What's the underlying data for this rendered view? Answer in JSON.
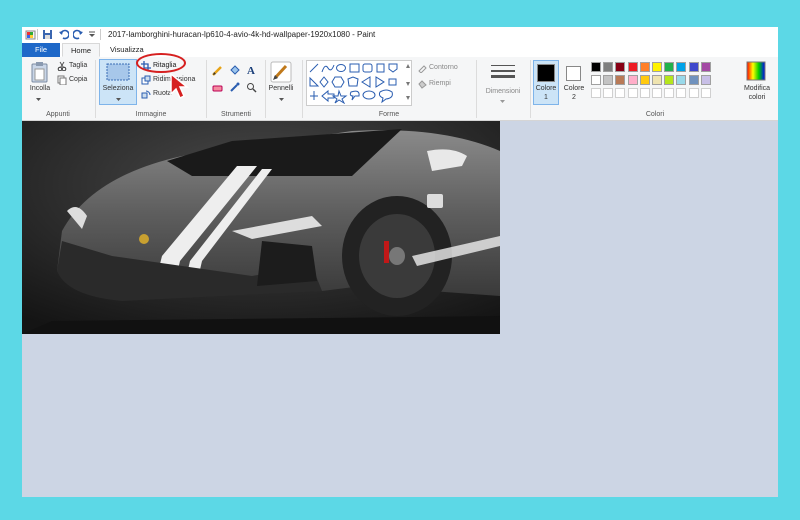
{
  "window": {
    "title": "2017-lamborghini-huracan-lp610-4-avio-4k-hd-wallpaper-1920x1080 - Paint"
  },
  "tabs": {
    "file": "File",
    "home": "Home",
    "view": "Visualizza"
  },
  "clipboard": {
    "paste": "Incolla",
    "cut": "Taglia",
    "copy": "Copia",
    "group": "Appunti"
  },
  "image": {
    "select": "Seleziona",
    "crop": "Ritaglia",
    "resize": "Ridimensiona",
    "rotate": "Ruota",
    "group": "Immagine"
  },
  "tools": {
    "group": "Strumenti",
    "brushes": "Pennelli"
  },
  "shapes": {
    "group": "Forme",
    "outline": "Contorno",
    "fill": "Riempi"
  },
  "size": {
    "label": "Dimensioni"
  },
  "colors": {
    "color1": "Colore",
    "color1_num": "1",
    "color2": "Colore",
    "color2_num": "2",
    "group": "Colori",
    "edit": "Modifica",
    "edit2": "colori",
    "palette_row1": [
      "#000000",
      "#7f7f7f",
      "#880015",
      "#ed1c24",
      "#ff7f27",
      "#fff200",
      "#22b14c",
      "#00a2e8",
      "#3f48cc",
      "#a349a4"
    ],
    "palette_row2": [
      "#ffffff",
      "#c3c3c3",
      "#b97a57",
      "#ffaec9",
      "#ffc90e",
      "#efe4b0",
      "#b5e61d",
      "#99d9ea",
      "#7092be",
      "#c8bfe7"
    ]
  }
}
